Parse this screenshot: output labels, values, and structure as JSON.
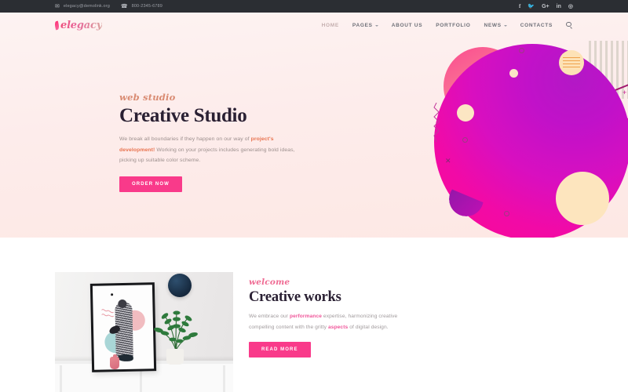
{
  "topbar": {
    "email": "elegacy@demolink.org",
    "phone": "800-2345-6789",
    "email_icon": "envelope-icon",
    "phone_icon": "phone-icon",
    "social": [
      {
        "name": "facebook-icon",
        "glyph": "f"
      },
      {
        "name": "twitter-icon",
        "glyph": "ᴛ"
      },
      {
        "name": "google-plus-icon",
        "glyph": "G+"
      },
      {
        "name": "linkedin-icon",
        "glyph": "in"
      },
      {
        "name": "instagram-icon",
        "glyph": "◎"
      }
    ]
  },
  "header": {
    "logo": "elegacy",
    "menu": [
      {
        "label": "HOME",
        "has_caret": false,
        "active": true
      },
      {
        "label": "PAGES",
        "has_caret": true,
        "active": false
      },
      {
        "label": "ABOUT US",
        "has_caret": false,
        "active": false
      },
      {
        "label": "PORTFOLIO",
        "has_caret": false,
        "active": false
      },
      {
        "label": "NEWS",
        "has_caret": true,
        "active": false
      },
      {
        "label": "CONTACTS",
        "has_caret": false,
        "active": false
      }
    ],
    "search_icon": "search-icon"
  },
  "hero": {
    "eyebrow": "web studio",
    "title": "Creative Studio",
    "paragraph_1": "We break all boundaries if they happen on our way of ",
    "paragraph_highlight": "project's development!",
    "paragraph_2": " Working on your projects includes generating bold ideas, picking up suitable color scheme.",
    "cta_label": "ORDER NOW"
  },
  "welcome": {
    "eyebrow": "welcome",
    "title": "Creative works",
    "paragraph_1": "We embrace our ",
    "highlight_1": "performance",
    "paragraph_2": " expertise, harmonizing creative compelling content with the gritty ",
    "highlight_2": "aspects",
    "paragraph_3": " of digital design.",
    "cta_label": "READ MORE",
    "image_alt": "framed-art-print-photo"
  },
  "colors": {
    "topbar_bg": "#2b2e33",
    "hero_bg": "#fdeceb",
    "accent_pink": "#f93a8a",
    "accent_magenta": "#e8119f",
    "heading": "#2a2033",
    "eyebrow_hero": "#d98b72",
    "eyebrow_welcome": "#ef6b93",
    "body_text": "#9c8f8d"
  }
}
